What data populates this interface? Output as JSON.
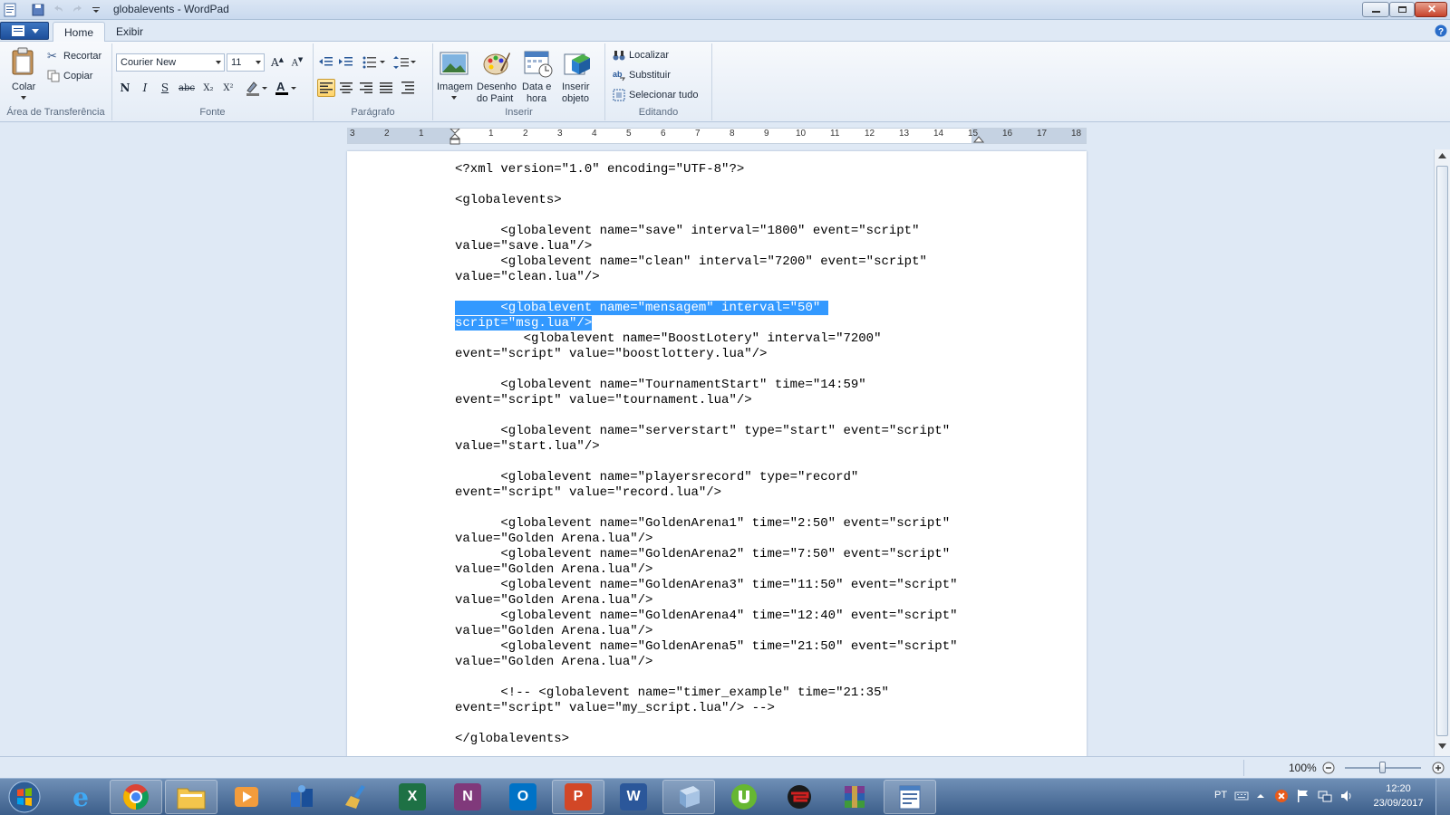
{
  "window": {
    "title": "globalevents - WordPad"
  },
  "tabs": [
    {
      "label": "Home",
      "active": true
    },
    {
      "label": "Exibir",
      "active": false
    }
  ],
  "ribbon": {
    "clipboard": {
      "label": "Área de Transferência",
      "paste": "Colar",
      "cut": "Recortar",
      "copy": "Copiar"
    },
    "font": {
      "label": "Fonte",
      "family": "Courier New",
      "size": "11",
      "bold": "N",
      "italic": "I",
      "underline": "S",
      "strike": "abc",
      "subscript": "X₂",
      "superscript": "X²"
    },
    "paragraph": {
      "label": "Parágrafo"
    },
    "insert": {
      "label": "Inserir",
      "image": "Imagem",
      "paint_line1": "Desenho",
      "paint_line2": "do Paint",
      "datetime_line1": "Data e",
      "datetime_line2": "hora",
      "object_line1": "Inserir",
      "object_line2": "objeto"
    },
    "editing": {
      "label": "Editando",
      "find": "Localizar",
      "replace": "Substituir",
      "select_all": "Selecionar tudo"
    }
  },
  "ruler": {
    "ticks": [
      "3",
      "2",
      "1",
      "1",
      "2",
      "3",
      "4",
      "5",
      "6",
      "7",
      "8",
      "9",
      "10",
      "11",
      "12",
      "13",
      "14",
      "15",
      "16",
      "17",
      "18"
    ]
  },
  "document": {
    "before_selection": "<?xml version=\"1.0\" encoding=\"UTF-8\"?>\n\n<globalevents>\n\n      <globalevent name=\"save\" interval=\"1800\" event=\"script\"\nvalue=\"save.lua\"/>\n      <globalevent name=\"clean\" interval=\"7200\" event=\"script\"\nvalue=\"clean.lua\"/>\n\n",
    "selection_line1": "      <globalevent name=\"mensagem\" interval=\"50\" ",
    "selection_line2": "script=\"msg.lua\"/>",
    "after_selection": "\n         <globalevent name=\"BoostLotery\" interval=\"7200\"\nevent=\"script\" value=\"boostlottery.lua\"/>\n\n      <globalevent name=\"TournamentStart\" time=\"14:59\"\nevent=\"script\" value=\"tournament.lua\"/>\n\n      <globalevent name=\"serverstart\" type=\"start\" event=\"script\"\nvalue=\"start.lua\"/>\n\n      <globalevent name=\"playersrecord\" type=\"record\"\nevent=\"script\" value=\"record.lua\"/>\n\n      <globalevent name=\"GoldenArena1\" time=\"2:50\" event=\"script\"\nvalue=\"Golden Arena.lua\"/>\n      <globalevent name=\"GoldenArena2\" time=\"7:50\" event=\"script\"\nvalue=\"Golden Arena.lua\"/>\n      <globalevent name=\"GoldenArena3\" time=\"11:50\" event=\"script\"\nvalue=\"Golden Arena.lua\"/>\n      <globalevent name=\"GoldenArena4\" time=\"12:40\" event=\"script\"\nvalue=\"Golden Arena.lua\"/>\n      <globalevent name=\"GoldenArena5\" time=\"21:50\" event=\"script\"\nvalue=\"Golden Arena.lua\"/>\n\n      <!-- <globalevent name=\"timer_example\" time=\"21:35\"\nevent=\"script\" value=\"my_script.lua\"/> -->\n\n</globalevents>"
  },
  "status": {
    "zoom": "100%"
  },
  "taskbar": {
    "apps": [
      "start-orb",
      "internet-explorer",
      "chrome",
      "file-explorer",
      "media-player",
      "network-app",
      "cleaner-app",
      "excel",
      "onenote",
      "outlook",
      "powerpoint",
      "word",
      "virtualbox",
      "utorrent",
      "game-client",
      "winrar",
      "wordpad"
    ],
    "language": "PT",
    "time": "12:20",
    "date": "23/09/2017"
  },
  "colors": {
    "selection": "#3399ff",
    "accent": "#1d4f9a"
  }
}
